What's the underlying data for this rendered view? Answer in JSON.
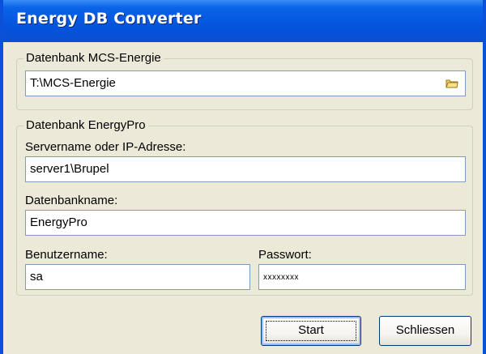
{
  "window": {
    "title": "Energy DB Converter"
  },
  "mcs_group": {
    "legend": "Datenbank MCS-Energie",
    "path_value": "T:\\MCS-Energie",
    "browse_icon": "folder-icon"
  },
  "energypro_group": {
    "legend": "Datenbank EnergyPro",
    "server_label": "Servername oder IP-Adresse:",
    "server_value": "server1\\Brupel",
    "dbname_label": "Datenbankname:",
    "dbname_value": "EnergyPro",
    "username_label": "Benutzername:",
    "username_value": "sa",
    "password_label": "Passwort:",
    "password_value": "xxxxxxxx"
  },
  "buttons": {
    "start_label": "Start",
    "close_label": "Schliessen"
  }
}
